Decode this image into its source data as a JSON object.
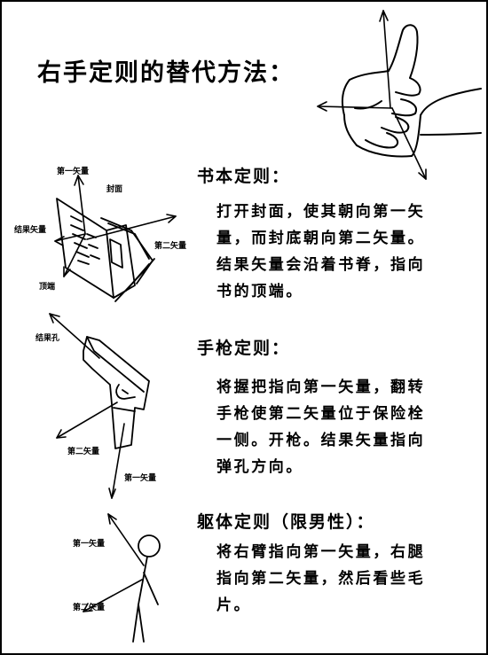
{
  "title": "右手定则的替代方法：",
  "sections": {
    "book": {
      "heading": "书本定则：",
      "lines": [
        "打开封面，使其朝向第一矢",
        "量，而封底朝向第二矢量。",
        "结果矢量会沿着书脊，指向",
        "书的顶端。"
      ],
      "labels": {
        "first": "第一矢量",
        "cover": "封面",
        "result": "结果矢量",
        "second": "第二矢量",
        "top": "顶端"
      }
    },
    "gun": {
      "heading": "手枪定则：",
      "lines": [
        "将握把指向第一矢量，翻转",
        "手枪使第二矢量位于保险栓",
        "一侧。开枪。结果矢量指向",
        "弹孔方向。"
      ],
      "labels": {
        "hole": "结果孔",
        "second": "第二矢量",
        "first": "第一矢量"
      }
    },
    "body": {
      "heading": "躯体定则（限男性）：",
      "lines": [
        "将右臂指向第一矢量，右腿",
        "指向第二矢量，然后看些毛",
        "片。"
      ],
      "labels": {
        "first": "第一矢量",
        "second": "第二矢量"
      }
    }
  }
}
